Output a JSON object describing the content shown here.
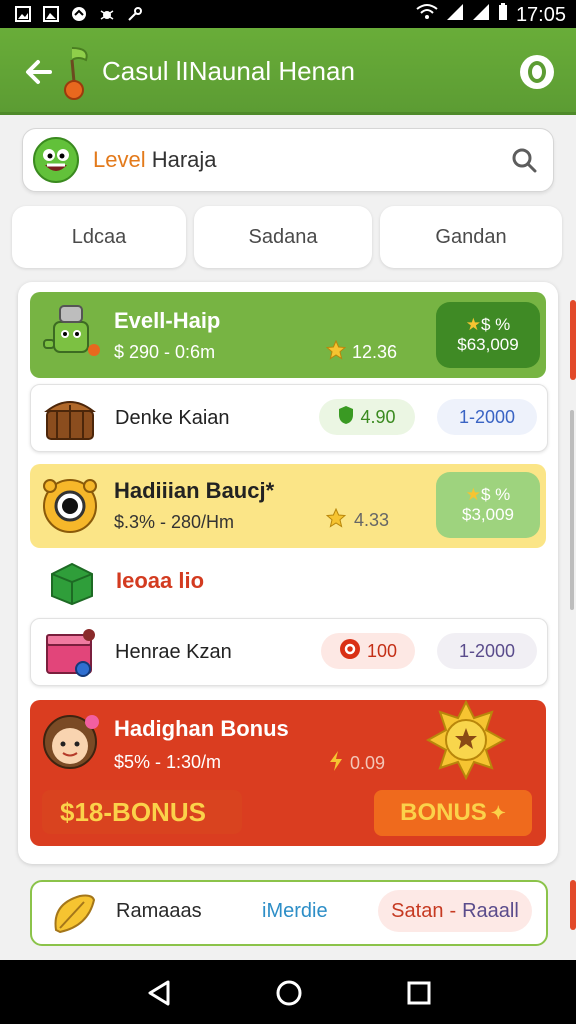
{
  "status_bar": {
    "time": "17:05",
    "left_icons": [
      "image-icon",
      "image-icon",
      "cloud-icon",
      "bug-icon",
      "key-icon"
    ],
    "right_icons": [
      "wifi-icon",
      "signal-icon",
      "signal-icon",
      "battery-icon"
    ]
  },
  "header": {
    "title": "Casul lINaunal Henan",
    "back_icon": "arrow-left-icon",
    "logo_icon": "fruit-logo-icon",
    "action_icon": "coin-icon"
  },
  "search": {
    "accent_text": "Level",
    "text": "Haraja",
    "icon": "search-icon"
  },
  "tabs": [
    {
      "label": "Ldcaa"
    },
    {
      "label": "Sadana"
    },
    {
      "label": "Gandan"
    }
  ],
  "list": [
    {
      "type": "featured",
      "title": "Evell-Haip",
      "subtitle": "$ 290 - 0:6m",
      "stat": "12.36",
      "badge_line1": "$ %",
      "badge_line2": "$63,009",
      "bg": "#77b443",
      "badge_bg": "#3f8a25",
      "icon": "robot-character-icon"
    },
    {
      "type": "item",
      "title": "Denke Kaian",
      "pill1": "4.90",
      "pill2": "1-2000",
      "icon": "treasure-chest-icon",
      "pill1_icon": "shield-icon"
    },
    {
      "type": "featured",
      "title": "Hadiiian Baucj*",
      "subtitle": "$.3% - 280/Hm",
      "stat": "4.33",
      "badge_line1": "$ %",
      "badge_line2": "$3,009",
      "bg": "#fbe587",
      "badge_bg": "#9ed37e",
      "icon": "camera-character-icon"
    },
    {
      "type": "section",
      "title": "Ieoaa lio",
      "icon": "green-cube-icon"
    },
    {
      "type": "item",
      "title": "Henrae Kzan",
      "pill1": "100",
      "pill2": "1-2000",
      "icon": "gift-box-icon",
      "pill1_icon": "coin-icon"
    },
    {
      "type": "bonus",
      "title": "Hadighan Bonus",
      "subtitle": "$5% - 1:30/m",
      "stat": "0.09",
      "bonus_left": "$18-BONUS",
      "bonus_right": "BONUS",
      "bg": "#da3d20",
      "icon": "girl-avatar-icon",
      "star_icon": "sun-star-icon"
    }
  ],
  "footer_card": {
    "left": "Ramaaas",
    "middle": "iMerdie",
    "right_prefix": "Satan",
    "right_suffix": "Raaall",
    "icon": "leaf-icon"
  },
  "nav": {
    "back": "back-triangle-icon",
    "home": "home-circle-icon",
    "recent": "recent-square-icon"
  }
}
